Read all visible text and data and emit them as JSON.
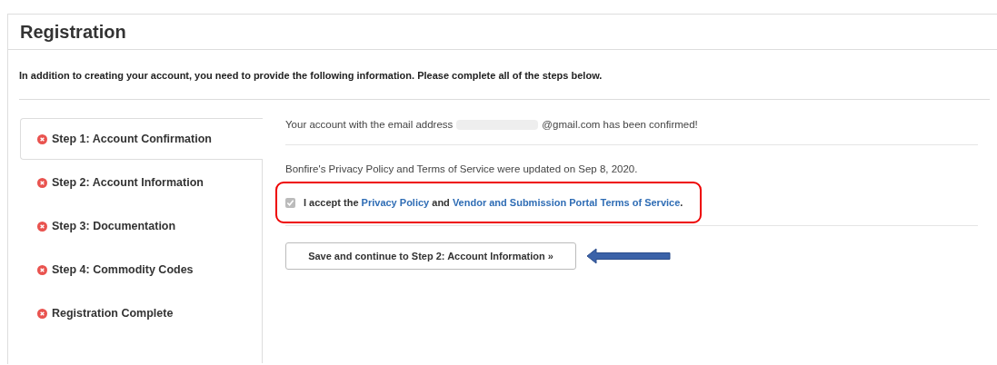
{
  "page": {
    "title": "Registration",
    "intro": "In addition to creating your account, you need to provide the following information. Please complete all of the steps below."
  },
  "steps": [
    {
      "label": "Step 1: Account Confirmation",
      "selected": true
    },
    {
      "label": "Step 2: Account Information",
      "selected": false
    },
    {
      "label": "Step 3: Documentation",
      "selected": false
    },
    {
      "label": "Step 4: Commodity Codes",
      "selected": false
    },
    {
      "label": "Registration Complete",
      "selected": false
    }
  ],
  "confirmation": {
    "before": "Your account with the email address",
    "after": "@gmail.com has been confirmed!"
  },
  "notice": "Bonfire's Privacy Policy and Terms of Service were updated on Sep 8, 2020.",
  "agreement": {
    "checked": true,
    "parts": [
      {
        "kind": "text",
        "text": "I accept the"
      },
      {
        "kind": "link",
        "text": "Privacy Policy"
      },
      {
        "kind": "text",
        "text": "and"
      },
      {
        "kind": "link",
        "text": "Vendor and Submission Portal Terms of Service"
      },
      {
        "kind": "end",
        "text": "."
      }
    ]
  },
  "button": "Save and continue to Step 2: Account Information »"
}
